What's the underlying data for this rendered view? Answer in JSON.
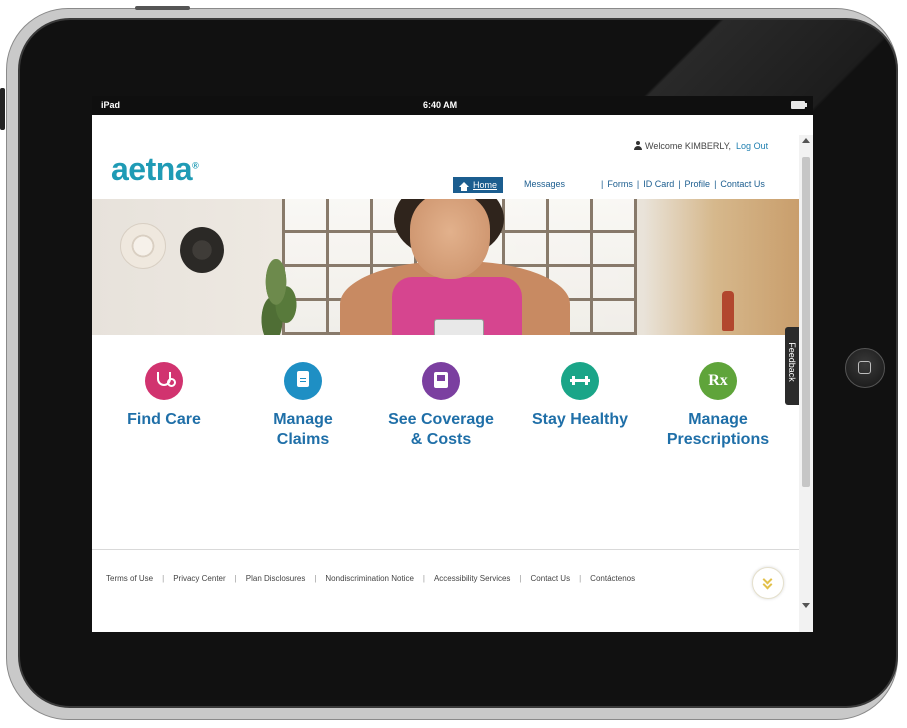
{
  "status_bar": {
    "device": "iPad",
    "time": "6:40 AM"
  },
  "header": {
    "logo": "aetna",
    "welcome": "Welcome KIMBERLY,",
    "logout": "Log Out",
    "nav": {
      "home": "Home",
      "messages": "Messages"
    },
    "util_links": [
      "Forms",
      "ID Card",
      "Profile",
      "Contact Us"
    ]
  },
  "tiles": [
    {
      "label_1": "Find Care",
      "label_2": "",
      "color": "#d1336f",
      "icon": "stethoscope-icon"
    },
    {
      "label_1": "Manage",
      "label_2": "Claims",
      "color": "#1e8fc4",
      "icon": "clipboard-icon"
    },
    {
      "label_1": "See Coverage",
      "label_2": "& Costs",
      "color": "#7b3fa0",
      "icon": "coverage-card-icon"
    },
    {
      "label_1": "Stay Healthy",
      "label_2": "",
      "color": "#1aa588",
      "icon": "dumbbell-icon"
    },
    {
      "label_1": "Manage",
      "label_2": "Prescriptions",
      "color": "#5fa43a",
      "icon": "rx-icon",
      "glyph": "Rx"
    }
  ],
  "feedback": "Feedback",
  "footer_links": [
    "Terms of Use",
    "Privacy Center",
    "Plan Disclosures",
    "Nondiscrimination Notice",
    "Accessibility Services",
    "Contact Us",
    "Contáctenos"
  ],
  "colors": {
    "brand": "#1f9bb5",
    "nav": "#1b5d8f",
    "tile_label": "#1f6fa8"
  }
}
